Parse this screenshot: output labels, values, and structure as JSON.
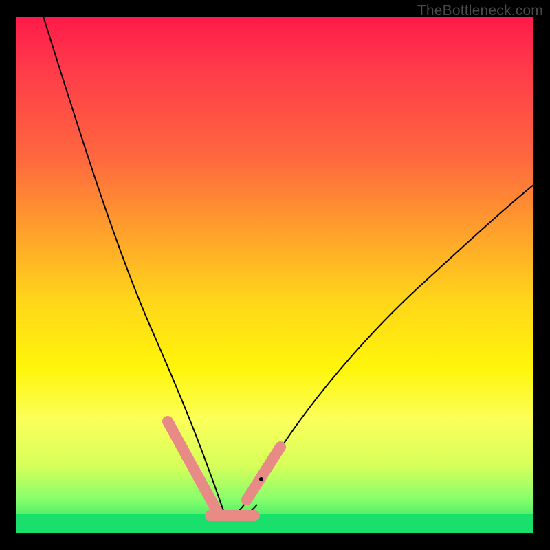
{
  "watermark": "TheBottleneck.com",
  "colors": {
    "page_bg": "#000000",
    "gradient_top": "#ff1a49",
    "gradient_bottom": "#18e06a",
    "curve": "#000000",
    "accent_pill": "#e88a86"
  },
  "chart_data": {
    "type": "line",
    "title": "",
    "xlabel": "",
    "ylabel": "",
    "xlim": [
      0,
      1
    ],
    "ylim": [
      0,
      1
    ],
    "grid": false,
    "note": "Coordinates are normalized 0–1 within the gradient frame; origin at top-left; y increases downward.",
    "series": [
      {
        "name": "left-branch",
        "x": [
          0.052,
          0.08,
          0.11,
          0.145,
          0.18,
          0.215,
          0.25,
          0.28,
          0.31,
          0.335,
          0.358,
          0.375,
          0.39,
          0.405
        ],
        "y": [
          0.0,
          0.11,
          0.22,
          0.34,
          0.45,
          0.555,
          0.65,
          0.73,
          0.795,
          0.855,
          0.905,
          0.94,
          0.965,
          0.98
        ]
      },
      {
        "name": "right-branch",
        "x": [
          0.405,
          0.42,
          0.44,
          0.47,
          0.51,
          0.56,
          0.62,
          0.69,
          0.77,
          0.86,
          0.955,
          1.0
        ],
        "y": [
          0.98,
          0.965,
          0.94,
          0.895,
          0.83,
          0.755,
          0.665,
          0.575,
          0.48,
          0.385,
          0.3,
          0.26
        ]
      }
    ],
    "accent_segments": [
      {
        "name": "left-pill",
        "x": [
          0.293,
          0.39
        ],
        "y": [
          0.783,
          0.96
        ]
      },
      {
        "name": "bottom-pill",
        "x": [
          0.375,
          0.46
        ],
        "y": [
          0.965,
          0.965
        ]
      },
      {
        "name": "right-pill",
        "x": [
          0.445,
          0.51
        ],
        "y": [
          0.935,
          0.833
        ]
      }
    ],
    "annotations": [
      {
        "name": "vertex-dot",
        "x": 0.474,
        "y": 0.895
      }
    ]
  }
}
